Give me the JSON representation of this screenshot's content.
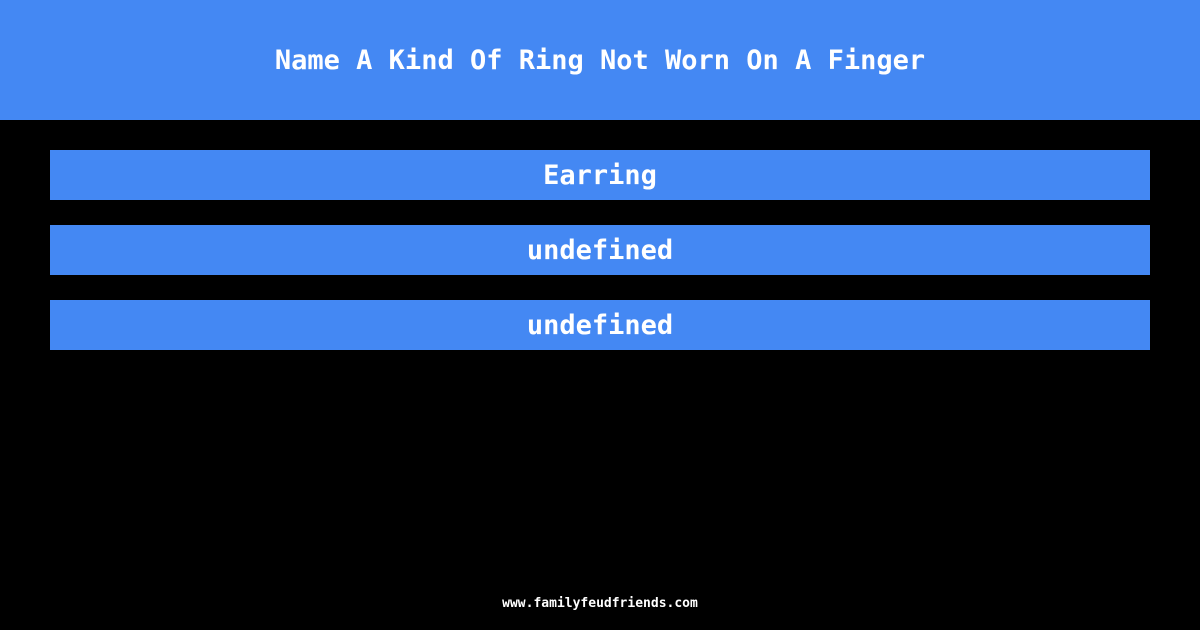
{
  "header": {
    "title": "Name A Kind Of Ring Not Worn On A Finger"
  },
  "answers": [
    {
      "label": "Earring"
    },
    {
      "label": "undefined"
    },
    {
      "label": "undefined"
    }
  ],
  "footer": {
    "url": "www.familyfeudfriends.com"
  },
  "colors": {
    "accent": "#4488f3",
    "background": "#000000",
    "text": "#ffffff"
  }
}
